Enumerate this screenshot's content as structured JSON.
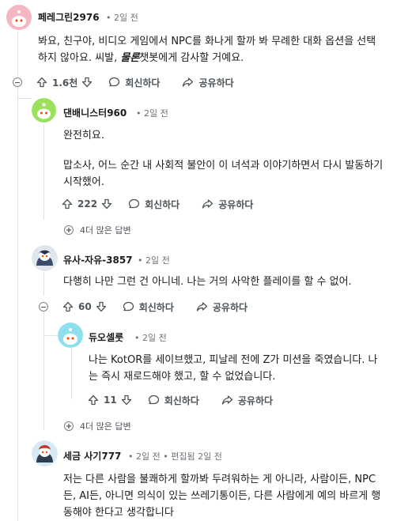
{
  "comments": [
    {
      "username": "페레그린2976",
      "time": "2일 전",
      "body": [
        "봐요, 친구야, 비디오 게임에서 NPC를 화나게 할까 봐 무례한 대화 옵션을 선택하지 않아요. 씨발, "
      ],
      "body_em": "물론",
      "body_tail": "챗봇에게 감사할 거예요.",
      "votes": "1.6천",
      "reply_label": "회신하다",
      "share_label": "공유하다"
    },
    {
      "username": "댄배니스터960",
      "time": "2일 전",
      "body": [
        "완전히요.",
        "맙소사, 어느 순간 내 사회적 불안이 이 녀석과 이야기하면서 다시 발동하기 시작했어."
      ],
      "votes": "222",
      "reply_label": "회신하다",
      "share_label": "공유하다",
      "more_replies": "4더 많은 답변"
    },
    {
      "username": "유사-자유-3857",
      "time": "2일 전",
      "body": [
        "다행히 나만 그런 건 아니네. 나는 거의 사악한 플레이를 할 수 없어."
      ],
      "votes": "60",
      "reply_label": "회신하다",
      "share_label": "공유하다"
    },
    {
      "username": "듀오셀룻",
      "time": "2일 전",
      "body": [
        "나는 KotOR를 세이브했고, 피날레 전에 Z가 미션을 죽였습니다. 나는 즉시 재로드해야 했고, 할 수 없었습니다."
      ],
      "votes": "11",
      "reply_label": "회신하다",
      "share_label": "공유하다",
      "more_replies": "4더 많은 답변"
    },
    {
      "username": "세금 사기777",
      "time": "2일 전",
      "edited": "편집됨 2일 전",
      "body": [
        "저는 다른 사람을 불쾌하게 할까봐 두려워하는 게 아니라, 사람이든, NPC든, AI든, 아니면 의식이 있는 쓰레기통이든, 다른 사람에게 예의 바르게 행동해야 한다고 생각합니다"
      ]
    }
  ],
  "colors": {
    "avatar1": "#f5b6c3",
    "avatar2": "#7fd245",
    "avatar3": "#3b4c6b",
    "avatar4": "#6fd1e6",
    "avatar5": "#2c3e50"
  },
  "dot": "•"
}
